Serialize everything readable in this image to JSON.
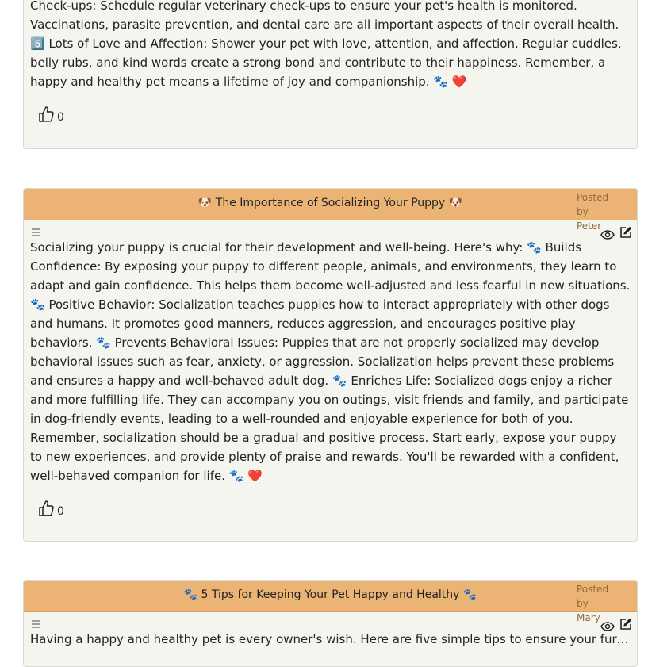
{
  "posts": [
    {
      "title": "",
      "author": "",
      "body": "Check-ups: Schedule regular veterinary check-ups to ensure your pet's health is monitored. Vaccinations, parasite prevention, and dental care are all important aspects of their overall health. 5️⃣ Lots of Love and Affection: Shower your pet with love, attention, and affection. Regular cuddles, belly rubs, and kind words create a strong bond and contribute to their happiness. Remember, a happy and healthy pet means a lifetime of joy and companionship. 🐾 ❤️",
      "likes": "0"
    },
    {
      "title": "🐶 The Importance of Socializing Your Puppy 🐶",
      "posted_by_label": "Posted by",
      "author": "Peter",
      "body": "Socializing your puppy is crucial for their development and well-being. Here's why: 🐾 Builds Confidence: By exposing your puppy to different people, animals, and environments, they learn to adapt and gain confidence. This helps them become well-adjusted and less fearful in new situations. 🐾 Positive Behavior: Socialization teaches puppies how to interact appropriately with other dogs and humans. It promotes good manners, reduces aggression, and encourages positive play behaviors. 🐾 Prevents Behavioral Issues: Puppies that are not properly socialized may develop behavioral issues such as fear, anxiety, or aggression. Socialization helps prevent these problems and ensures a happy and well-behaved adult dog. 🐾 Enriches Life: Socialized dogs enjoy a richer and more fulfilling life. They can accompany you on outings, visit friends and family, and participate in dog-friendly events, leading to a well-rounded and enjoyable experience for both of you. Remember, socialization should be a gradual and positive process. Start early, expose your puppy to new experiences, and provide plenty of praise and rewards. You'll be rewarded with a confident, well-behaved companion for life. 🐾 ❤️",
      "likes": "0"
    },
    {
      "title": "🐾 5 Tips for Keeping Your Pet Happy and Healthy 🐾",
      "posted_by_label": "Posted by",
      "author": "Mary",
      "body": "Having a happy and healthy pet is every owner's wish. Here are five simple tips to ensure your furry friend..."
    }
  ],
  "icons": {
    "menu": "menu-icon",
    "view": "eye-icon",
    "edit": "edit-icon",
    "like": "thumbs-up-icon"
  },
  "colors": {
    "header": "#ebb474",
    "card_bg": "#f5f5f0"
  }
}
